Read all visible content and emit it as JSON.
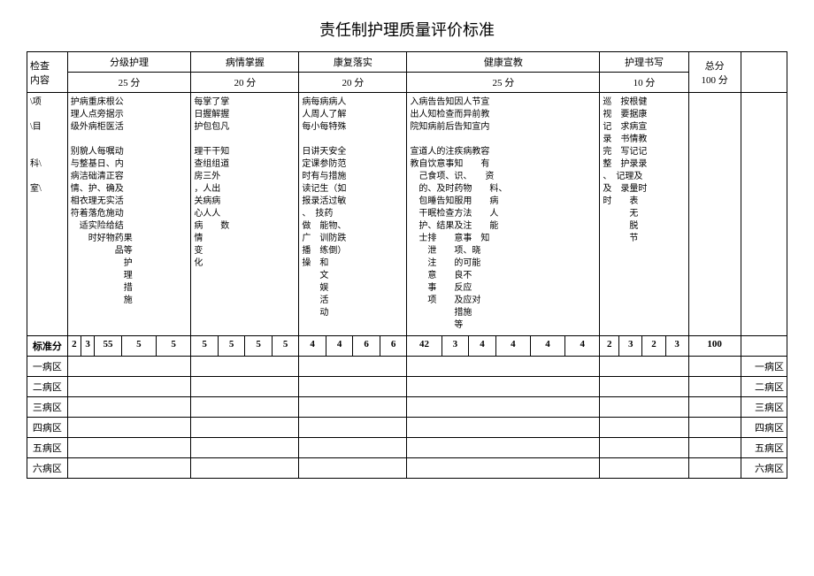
{
  "title": "责任制护理质量评价标准",
  "header": {
    "check_label": "检查\n内容",
    "project_label": "\\项\n\n\\目\n\n\n科\\\n\n室\\",
    "sections": {
      "nursing_level": {
        "label": "分级护理",
        "score": "25 分"
      },
      "condition": {
        "label": "病情掌握",
        "score": "20 分"
      },
      "rehab": {
        "label": "康复落实",
        "score": "20 分"
      },
      "health_edu": {
        "label": "健康宣教",
        "score": "25 分"
      },
      "writing": {
        "label": "护理书写",
        "score": "10 分"
      },
      "total": {
        "label": "总分",
        "score": "100 分"
      }
    }
  },
  "content": {
    "nursing_level": "护病重床根公\n理人点旁据示\n级外病柜医活\n\n别貌人每嘱动\n与整基日、内\n病洁础清正容\n情、护、确及\n相衣理无实活\n符着落危施动\n　适实险给结\n　　时好物药果\n　　　　　品等\n　　　　　　护\n　　　　　　理\n　　　　　　措\n　　　　　　施",
    "condition": "每掌了掌\n日握解握\n护包包凡\n\n理干干知\n查组组道\n房三外\n，人出\n关病病\n心人人\n病　　数\n情\n变\n化",
    "rehab": "病每病病人\n人周人了解\n每小每特殊\n\n日讲天安全\n定课参防范\n时有与措施\n读记生（如\n报录活过敏\n、　技药\n做　能物、\n广　训防跌\n播　练倒）\n操　和\n　　文\n　　娱\n　　活\n　　动",
    "health_edu": "入病告告知因人节宣\n出人知检查而异前教\n院知病前后告知宣内\n\n宣道人的注疾病教容\n教自饮意事知　　有\n　己食项、识、　　资\n　的、及时药物　　料、\n　包睡告知服用　　病\n　干眠检查方法　　人\n　护、结果及注　　能\n　士排　　意事　知\n　　泄　　项、晓\n　　注　　的可能\n　　意　　良不\n　　事　　反应\n　　项　　及应对\n　　　　　措施\n　　　　　等",
    "writing": "巡　按根健\n视　要据康\n记　求病宣\n录　书情教\n完　写记记\n整　护录录\n、　记理及\n及　录量时\n时　　表\n　　　无\n　　　脱\n　　　节"
  },
  "std_scores": {
    "label": "标准分",
    "nursing_level": [
      "2",
      "3",
      "55",
      "5",
      "5"
    ],
    "condition": [
      "5",
      "5",
      "5",
      "5"
    ],
    "rehab": [
      "4",
      "4",
      "6",
      "6"
    ],
    "health_edu": [
      "42",
      "3",
      "4",
      "4",
      "4",
      "4"
    ],
    "writing": [
      "2",
      "3",
      "2",
      "3"
    ],
    "total": "100"
  },
  "wards": [
    "一病区",
    "二病区",
    "三病区",
    "四病区",
    "五病区",
    "六病区"
  ]
}
